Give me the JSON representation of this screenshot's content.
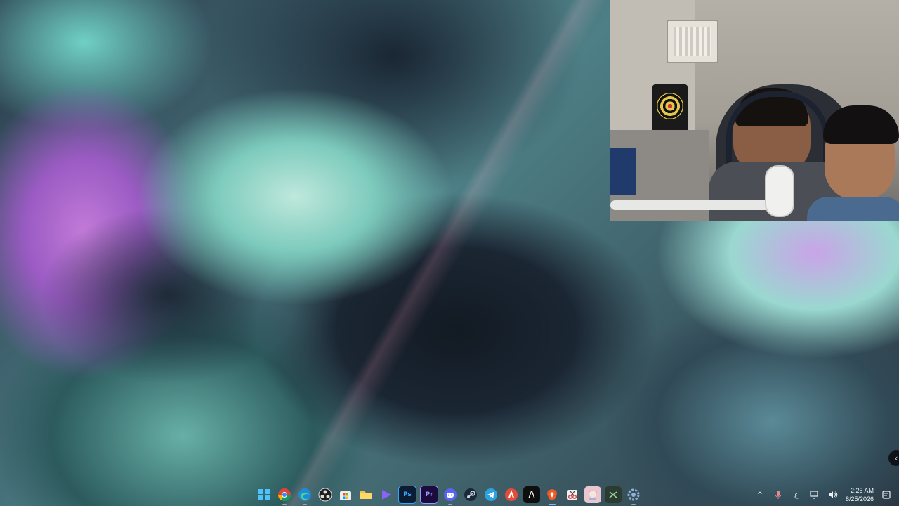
{
  "desktop": {
    "wallpaper": "abstract fluid teal-purple"
  },
  "webcam": {
    "visible": true
  },
  "taskbar": {
    "apps": [
      {
        "name": "start",
        "icon": "windows-icon",
        "color": "#3aa6f5"
      },
      {
        "name": "chrome",
        "icon": "chrome-icon",
        "color": "#e8e8e8"
      },
      {
        "name": "edge",
        "icon": "edge-icon",
        "color": "#1e8bd9"
      },
      {
        "name": "obs",
        "icon": "obs-icon",
        "color": "#262626"
      },
      {
        "name": "store",
        "icon": "microsoft-store-icon",
        "color": "#f3f3f3"
      },
      {
        "name": "explorer",
        "icon": "folder-icon",
        "color": "#f4c04a"
      },
      {
        "name": "media",
        "icon": "media-player-icon",
        "color": "#7f5cf0"
      },
      {
        "name": "photoshop",
        "icon": "photoshop-icon",
        "color": "#0b1c33",
        "label": "Ps"
      },
      {
        "name": "premiere",
        "icon": "premiere-icon",
        "color": "#1b0c3d",
        "label": "Pr"
      },
      {
        "name": "discord",
        "icon": "discord-icon",
        "color": "#5865f2"
      },
      {
        "name": "steam",
        "icon": "steam-icon",
        "color": "#1b2838"
      },
      {
        "name": "telegram",
        "icon": "telegram-icon",
        "color": "#2aa3e0"
      },
      {
        "name": "app-red",
        "icon": "red-circle-app-icon",
        "color": "#e34b3a"
      },
      {
        "name": "app-lambda",
        "icon": "lambda-icon",
        "color": "#0e0e0e",
        "label": "Λ"
      },
      {
        "name": "brave",
        "icon": "brave-icon",
        "color": "#f05a24"
      },
      {
        "name": "snipping",
        "icon": "snipping-tool-icon",
        "color": "#e8e8e8"
      },
      {
        "name": "app-anime",
        "icon": "anime-app-icon",
        "color": "#e8c7d1"
      },
      {
        "name": "app-terminal",
        "icon": "terminal-icon",
        "color": "#2b3b2f"
      },
      {
        "name": "settings",
        "icon": "settings-icon",
        "color": "#3a4a5d"
      }
    ],
    "tray": {
      "chevron": "^",
      "ime": "ع",
      "time": "2:25 AM",
      "date": "8/25/2026"
    }
  }
}
